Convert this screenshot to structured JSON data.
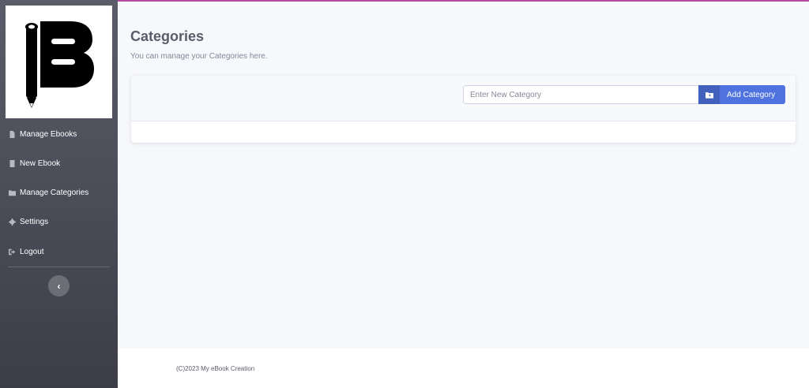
{
  "sidebar": {
    "logo_icon": "book-pencil-logo",
    "items": [
      {
        "label": "Manage Ebooks",
        "icon": "file-icon"
      },
      {
        "label": "New Ebook",
        "icon": "book-icon"
      },
      {
        "label": "Manage Categories",
        "icon": "folder-icon"
      },
      {
        "label": "Settings",
        "icon": "gear-icon"
      },
      {
        "label": "Logout",
        "icon": "sign-out-icon"
      }
    ],
    "collapse_glyph": "‹"
  },
  "main": {
    "title": "Categories",
    "subtitle": "You can manage your Categories here.",
    "form": {
      "input_placeholder": "Enter New Category",
      "input_value": "",
      "add_label": "Add Category",
      "add_icon": "folder-plus-icon"
    }
  },
  "footer": {
    "text": "(C)2023 My eBook Creation"
  },
  "colors": {
    "sidebar_top": "#5a5c69",
    "sidebar_bottom": "#3c3d47",
    "accent": "#4e73df",
    "top_border": "#b84ba0",
    "content_bg": "#f7f8fc"
  }
}
